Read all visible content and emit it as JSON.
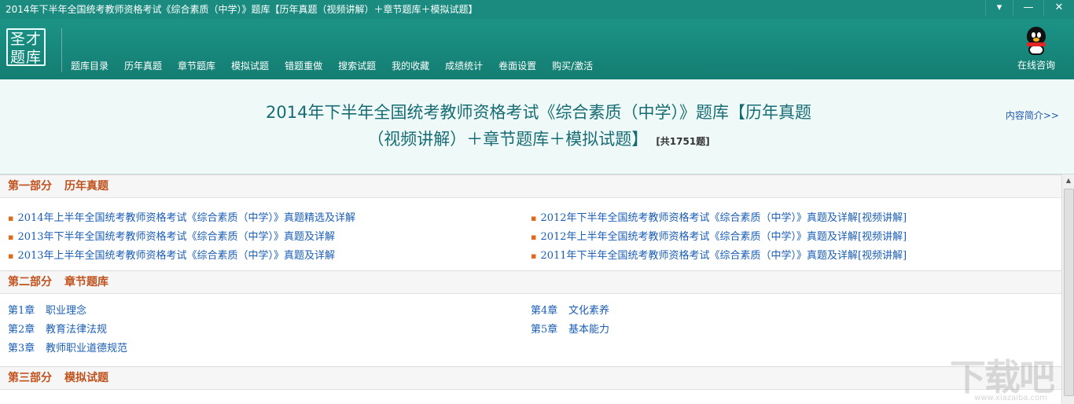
{
  "window": {
    "title": "2014年下半年全国统考教师资格考试《综合素质（中学）》题库【历年真题（视频讲解）＋章节题库＋模拟试题】",
    "buttons": [
      "▾",
      "—",
      "✕"
    ]
  },
  "logo": {
    "line1": "圣才",
    "line2": "题库"
  },
  "nav": {
    "items": [
      "题库目录",
      "历年真题",
      "章节题库",
      "模拟试题",
      "错题重做",
      "搜索试题",
      "我的收藏",
      "成绩统计",
      "卷面设置",
      "购买/激活"
    ]
  },
  "consult": {
    "label": "在线咨询",
    "icon": "qq-penguin-icon"
  },
  "header": {
    "title_line1": "2014年下半年全国统考教师资格考试《综合素质（中学）》题库【历年真题",
    "title_line2": "（视频讲解）＋章节题库＋模拟试题】",
    "count": "[共1751题]",
    "intro_link": "内容简介>>"
  },
  "sections": {
    "part1": {
      "part": "第一部分",
      "name": "历年真题",
      "items": [
        "2014年上半年全国统考教师资格考试《综合素质（中学）》真题精选及详解",
        "2012年下半年全国统考教师资格考试《综合素质（中学）》真题及详解[视频讲解]",
        "2013年下半年全国统考教师资格考试《综合素质（中学）》真题及详解",
        "2012年上半年全国统考教师资格考试《综合素质（中学）》真题及详解[视频讲解]",
        "2013年上半年全国统考教师资格考试《综合素质（中学）》真题及详解",
        "2011年下半年全国统考教师资格考试《综合素质（中学）》真题及详解[视频讲解]"
      ]
    },
    "part2": {
      "part": "第二部分",
      "name": "章节题库",
      "chapters": [
        {
          "num": "第1章",
          "title": "职业理念"
        },
        {
          "num": "第4章",
          "title": "文化素养"
        },
        {
          "num": "第2章",
          "title": "教育法律法规"
        },
        {
          "num": "第5章",
          "title": "基本能力"
        },
        {
          "num": "第3章",
          "title": "教师职业道德规范"
        }
      ]
    },
    "part3": {
      "part": "第三部分",
      "name": "模拟试题"
    }
  },
  "watermark": {
    "text": "下载吧",
    "sub": "www.xiazaiba.com"
  }
}
